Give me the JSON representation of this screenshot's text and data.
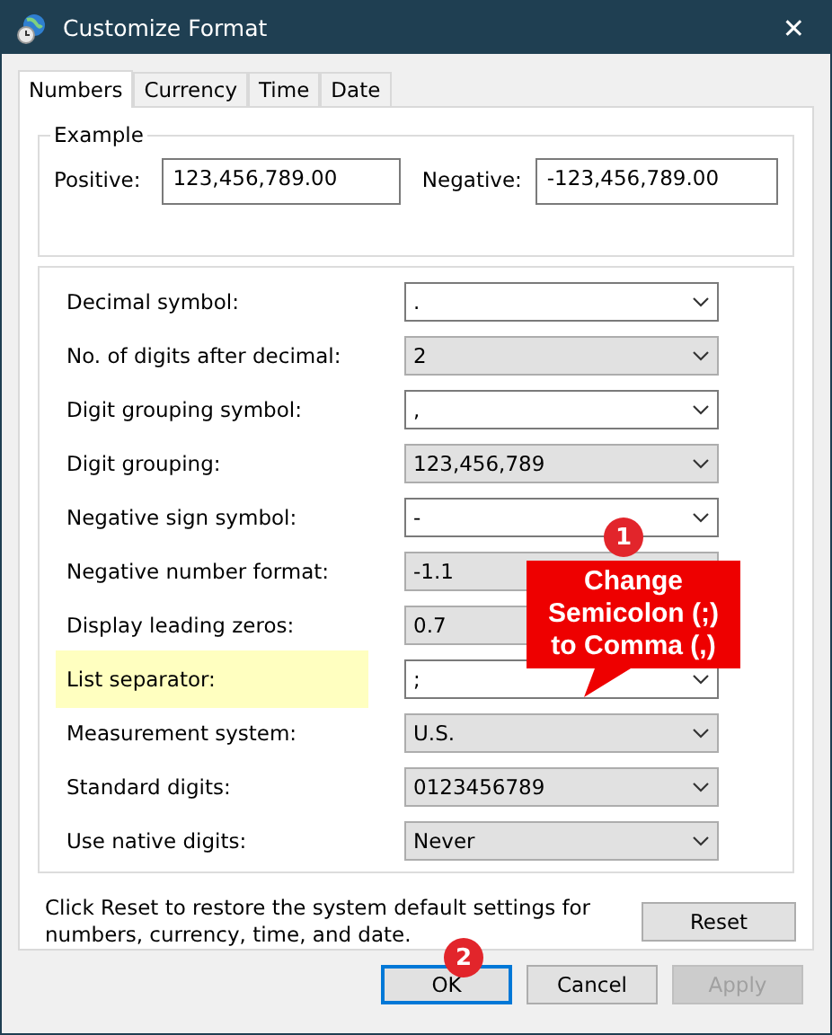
{
  "window": {
    "title": "Customize Format",
    "close": "✕"
  },
  "tabs": [
    {
      "label": "Numbers",
      "selected": true
    },
    {
      "label": "Currency",
      "selected": false
    },
    {
      "label": "Time",
      "selected": false
    },
    {
      "label": "Date",
      "selected": false
    }
  ],
  "example": {
    "title": "Example",
    "positive_label": "Positive:",
    "positive": "123,456,789.00",
    "negative_label": "Negative:",
    "negative": "-123,456,789.00"
  },
  "settings": [
    {
      "label": "Decimal symbol:",
      "value": ".",
      "kind": "editable",
      "highlighted": false
    },
    {
      "label": "No. of digits after decimal:",
      "value": "2",
      "kind": "list",
      "highlighted": false
    },
    {
      "label": "Digit grouping symbol:",
      "value": ",",
      "kind": "editable",
      "highlighted": false
    },
    {
      "label": "Digit grouping:",
      "value": "123,456,789",
      "kind": "list",
      "highlighted": false
    },
    {
      "label": "Negative sign symbol:",
      "value": "-",
      "kind": "editable",
      "highlighted": false
    },
    {
      "label": "Negative number format:",
      "value": "-1.1",
      "kind": "list",
      "highlighted": false
    },
    {
      "label": "Display leading zeros:",
      "value": "0.7",
      "kind": "list",
      "highlighted": false
    },
    {
      "label": "List separator:",
      "value": ";",
      "kind": "editable",
      "highlighted": true
    },
    {
      "label": "Measurement system:",
      "value": "U.S.",
      "kind": "list",
      "highlighted": false
    },
    {
      "label": "Standard digits:",
      "value": "0123456789",
      "kind": "list",
      "highlighted": false
    },
    {
      "label": "Use native digits:",
      "value": "Never",
      "kind": "list",
      "highlighted": false
    }
  ],
  "reset_note": "Click Reset to restore the system default settings for numbers, currency, time, and date.",
  "reset_button": "Reset",
  "buttons": [
    {
      "label": "OK",
      "disabled": false,
      "focused": true
    },
    {
      "label": "Cancel",
      "disabled": false,
      "focused": false
    },
    {
      "label": "Apply",
      "disabled": true,
      "focused": false
    }
  ],
  "annotations": {
    "callout": "Change Semicolon (;) to Comma (,)",
    "badges": [
      "1",
      "2"
    ]
  }
}
